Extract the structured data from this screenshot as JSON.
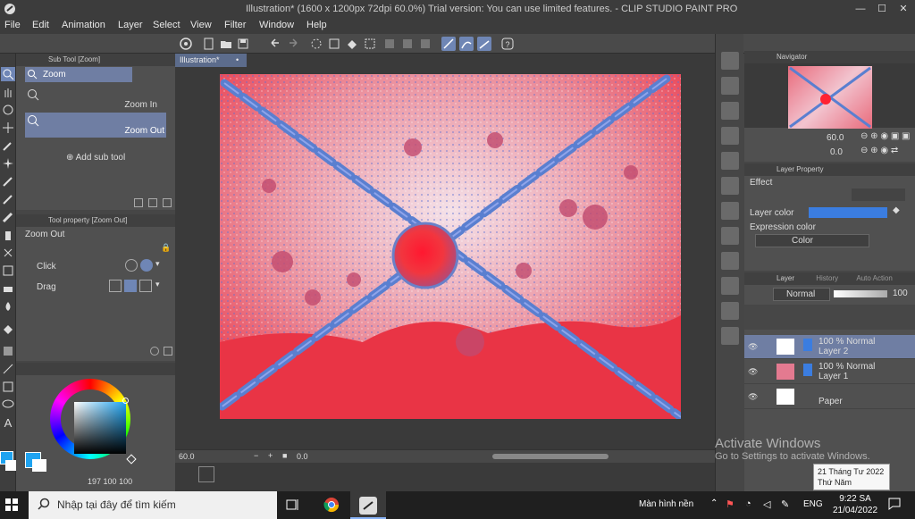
{
  "window": {
    "title": "Illustration* (1600 x 1200px 72dpi 60.0%)  Trial version: You can use limited features. - CLIP STUDIO PAINT PRO",
    "minimize": "—",
    "maximize": "☐",
    "close": "✕"
  },
  "menu": [
    "File",
    "Edit",
    "Animation",
    "Layer",
    "Select",
    "View",
    "Filter",
    "Window",
    "Help"
  ],
  "subtool": {
    "header": "Sub Tool [Zoom]",
    "group": "Zoom",
    "items": [
      "Zoom In",
      "Zoom Out"
    ],
    "add_label": "Add sub tool"
  },
  "toolprop": {
    "header": "Tool property [Zoom Out]",
    "title": "Zoom Out",
    "rows": [
      "Click",
      "Drag"
    ]
  },
  "color": {
    "main": "#1fa3f0",
    "sub": "#ffffff",
    "values": [
      "197",
      "100",
      "100"
    ]
  },
  "document": {
    "tab": "Illustration*"
  },
  "canvas_status": {
    "zoom": "60.0",
    "angle": "0.0"
  },
  "navigator": {
    "header": "Navigator",
    "zoom": "60.0",
    "angle": "0.0"
  },
  "layer_property": {
    "header": "Layer Property",
    "effect_label": "Effect",
    "layer_color_label": "Layer color",
    "layer_color": "#3b7de0",
    "expression_label": "Expression color",
    "expression_value": "Color"
  },
  "layer_panel": {
    "tabs": [
      "Layer",
      "History",
      "Auto Action"
    ],
    "blend": "Normal",
    "opacity": "100",
    "layers": [
      {
        "mode": "100 % Normal",
        "name": "Layer 2",
        "selected": true
      },
      {
        "mode": "100 % Normal",
        "name": "Layer 1",
        "selected": false
      },
      {
        "mode": "",
        "name": "Paper",
        "selected": false
      }
    ]
  },
  "watermark": {
    "line1": "Activate Windows",
    "line2": "Go to Settings to activate Windows."
  },
  "date_tooltip": {
    "line1": "21 Tháng Tư 2022",
    "line2": "Thứ Năm"
  },
  "taskbar": {
    "search_placeholder": "Nhập tại đây để tìm kiếm",
    "screen_label": "Màn hình nền",
    "lang": "ENG",
    "time": "9:22 SA",
    "date": "21/04/2022"
  },
  "colors": {
    "accent": "#6f86b5",
    "canvas_red": "#ee3344",
    "chain_blue": "#5a7fd0"
  }
}
